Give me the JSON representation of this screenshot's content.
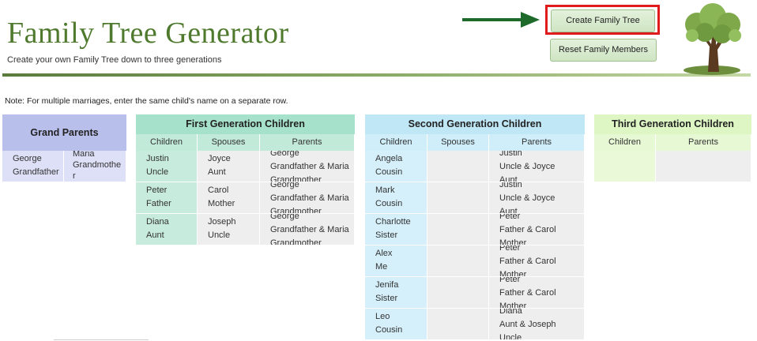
{
  "header": {
    "title": "Family Tree Generator",
    "subtitle": "Create your own Family Tree down to three generations"
  },
  "buttons": {
    "create_label": "Create Family Tree",
    "reset_label": "Reset Family Members"
  },
  "note": "Note: For multiple marriages, enter the same child's name on a separate row.",
  "colors": {
    "title": "#4f7a2e",
    "grandparents": "#b9bfeb",
    "first_gen": "#a6e1cc",
    "second_gen": "#bfe7f6",
    "third_gen": "#def5c4",
    "highlight": "#e01b1b",
    "arrow": "#1e6a2a"
  },
  "grand_parents": {
    "title": "Grand Parents",
    "rows": [
      {
        "a1": "George",
        "a2": "Grandfather",
        "b1": "Maria",
        "b2": "Grandmothe",
        "b3": "r"
      }
    ]
  },
  "first_gen": {
    "title": "First Generation Children",
    "columns": [
      "Children",
      "Spouses",
      "Parents"
    ],
    "rows": [
      {
        "c1": "Justin",
        "c2": "Uncle",
        "s1": "Joyce",
        "s2": "Aunt",
        "p1": "George",
        "p2": "Grandfather & Maria",
        "p3": "Grandmother"
      },
      {
        "c1": "Peter",
        "c2": "Father",
        "s1": "Carol",
        "s2": "Mother",
        "p1": "George",
        "p2": "Grandfather & Maria",
        "p3": "Grandmother"
      },
      {
        "c1": "Diana",
        "c2": "Aunt",
        "s1": "Joseph",
        "s2": "Uncle",
        "p1": "George",
        "p2": "Grandfather & Maria",
        "p3": "Grandmother"
      }
    ]
  },
  "second_gen": {
    "title": "Second Generation Children",
    "columns": [
      "Children",
      "Spouses",
      "Parents"
    ],
    "rows": [
      {
        "c1": "Angela",
        "c2": "Cousin",
        "p1": "Justin",
        "p2": "Uncle & Joyce",
        "p3": "Aunt"
      },
      {
        "c1": "Mark",
        "c2": "Cousin",
        "p1": "Justin",
        "p2": "Uncle & Joyce",
        "p3": "Aunt"
      },
      {
        "c1": "Charlotte",
        "c2": "Sister",
        "p1": "Peter",
        "p2": "Father & Carol",
        "p3": "Mother"
      },
      {
        "c1": "Alex",
        "c2": "Me",
        "p1": "Peter",
        "p2": "Father & Carol",
        "p3": "Mother"
      },
      {
        "c1": "Jenifa",
        "c2": "Sister",
        "p1": "Peter",
        "p2": "Father & Carol",
        "p3": "Mother"
      },
      {
        "c1": "Leo",
        "c2": "Cousin",
        "p1": "Diana",
        "p2": "Aunt & Joseph",
        "p3": "Uncle"
      }
    ]
  },
  "third_gen": {
    "title": "Third Generation Children",
    "columns": [
      "Children",
      "Parents"
    ]
  }
}
